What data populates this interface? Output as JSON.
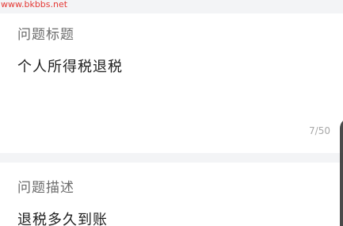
{
  "watermark": "www.bkbbs.net",
  "title_section": {
    "label": "问题标题",
    "value": "个人所得税退税",
    "counter": "7/50"
  },
  "description_section": {
    "label": "问题描述",
    "value": "退税多久到账"
  }
}
